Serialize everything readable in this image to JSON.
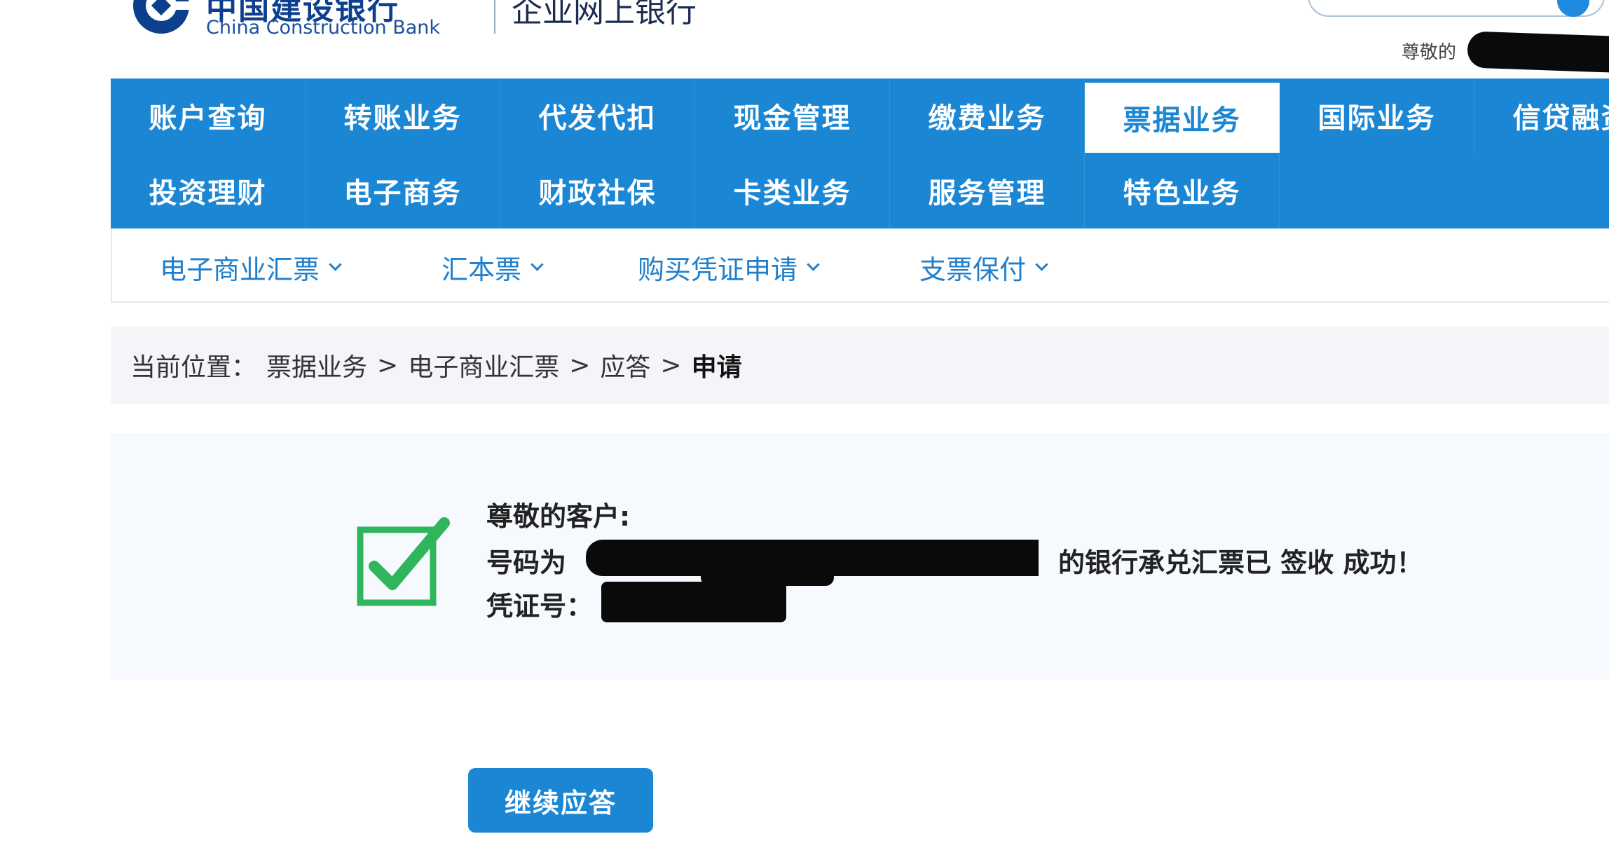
{
  "header": {
    "brand_cn": "中国建设银行",
    "brand_en": "China Construction Bank",
    "brand_sub": "企业网上银行",
    "greeting_prefix": "尊敬的"
  },
  "nav": {
    "row1": [
      "账户查询",
      "转账业务",
      "代发代扣",
      "现金管理",
      "缴费业务",
      "票据业务",
      "国际业务",
      "信贷融资"
    ],
    "row2": [
      "投资理财",
      "电子商务",
      "财政社保",
      "卡类业务",
      "服务管理",
      "特色业务"
    ],
    "active": "票据业务"
  },
  "subnav": [
    "电子商业汇票",
    "汇本票",
    "购买凭证申请",
    "支票保付"
  ],
  "breadcrumb": {
    "prefix": "当前位置：",
    "items": [
      "票据业务",
      "电子商业汇票",
      "应答"
    ],
    "current": "申请",
    "separator": ">"
  },
  "result": {
    "salutation": "尊敬的客户:",
    "number_label": "号码为",
    "success_text": "的银行承兑汇票已 签收 成功！",
    "voucher_label": "凭证号："
  },
  "button": {
    "continue_label": "继续应答"
  },
  "colors": {
    "primary_blue": "#1a86d4",
    "brand_navy": "#0d3f8f",
    "success_green": "#2fb65d",
    "panel_bg": "#f6f9fd",
    "breadcrumb_bg": "#f3f5f8"
  }
}
